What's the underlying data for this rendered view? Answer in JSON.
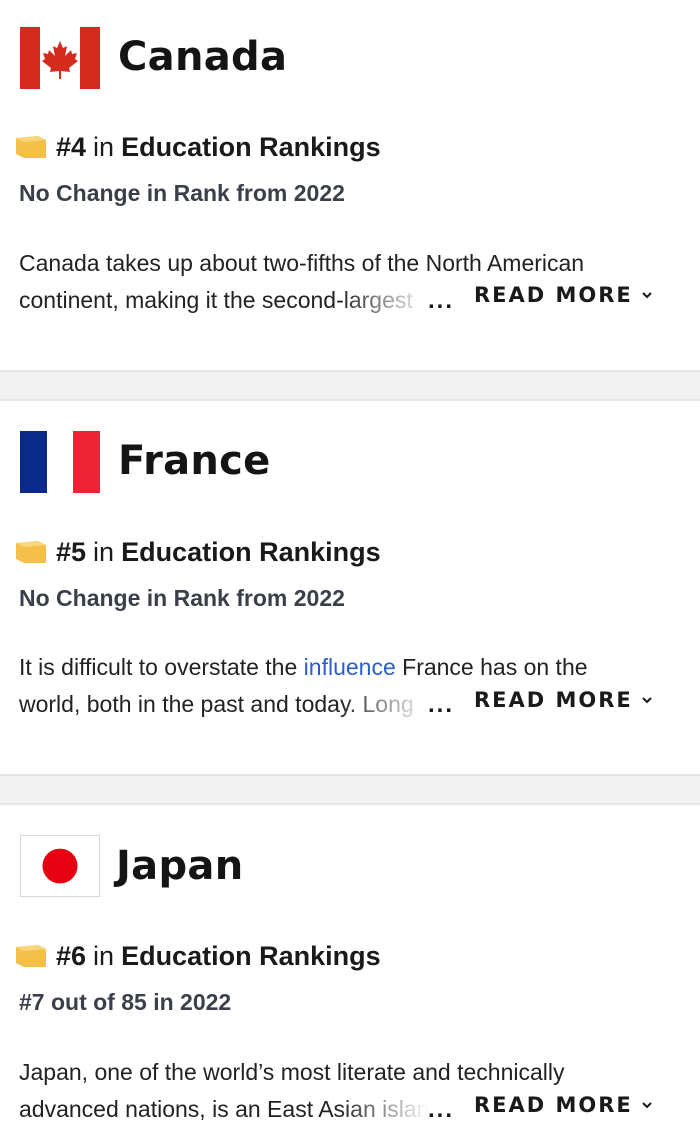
{
  "colors": {
    "badge": "#f5c04a",
    "link": "#2b5fc8",
    "canada_red": "#d52b1e",
    "france_blue": "#0c2a8c",
    "france_red": "#ee2436",
    "japan_red": "#e60012"
  },
  "icons": {
    "badge": "ribbon-badge-icon",
    "expand": "chevron-down-icon"
  },
  "countries": [
    {
      "name": "Canada",
      "flag": "canada-flag-icon",
      "rank": "#4",
      "rank_in": "in",
      "rank_list": "Education Rankings",
      "change": "No Change in Rank from 2022",
      "desc_line_1": "Canada takes up about two-fifths of the North American",
      "desc_line_2": "continent, making it the second-largest",
      "ellipsis": "...",
      "read_more": "READ MORE"
    },
    {
      "name": "France",
      "flag": "france-flag-icon",
      "rank": "#5",
      "rank_in": "in",
      "rank_list": "Education Rankings",
      "change": "No Change in Rank from 2022",
      "desc_line_1_before": "It is difficult to overstate the ",
      "desc_line_1_link": "influence",
      "desc_line_1_after": " France has on the",
      "desc_line_2": "world, both in the past and today. Long",
      "ellipsis": "...",
      "read_more": "READ MORE"
    },
    {
      "name": "Japan",
      "flag": "japan-flag-icon",
      "rank": "#6",
      "rank_in": "in",
      "rank_list": "Education Rankings",
      "change": "#7 out of 85 in 2022",
      "desc_line_1": "Japan, one of the world’s most literate and technically",
      "desc_line_2": "advanced nations, is an East Asian island",
      "ellipsis": "...",
      "read_more": "READ MORE"
    }
  ]
}
